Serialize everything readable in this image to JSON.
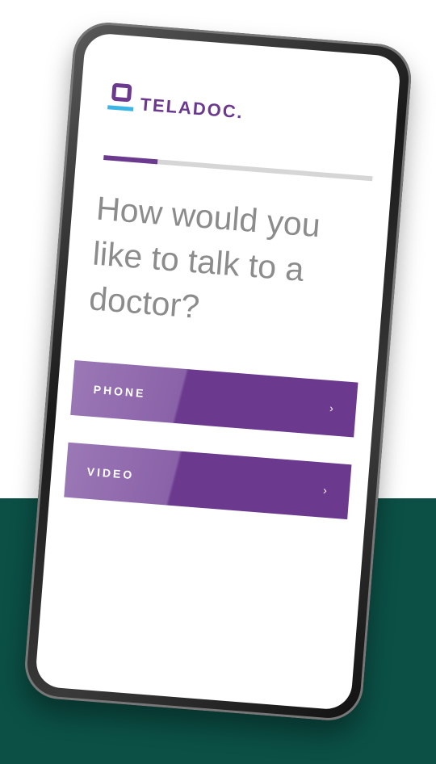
{
  "brand": {
    "name": "TELADOC."
  },
  "onboarding": {
    "progress": 0.2,
    "question": "How would you like to talk to a doctor?"
  },
  "options": [
    {
      "label": "PHONE",
      "arrow": "›"
    },
    {
      "label": "VIDEO",
      "arrow": "›"
    }
  ],
  "colors": {
    "accent": "#6b3a8e",
    "accent_light": "#9b78b6",
    "logo_dash": "#3bb5e6",
    "background_band": "#0b4f45",
    "progress_track": "#d6d6d6"
  }
}
